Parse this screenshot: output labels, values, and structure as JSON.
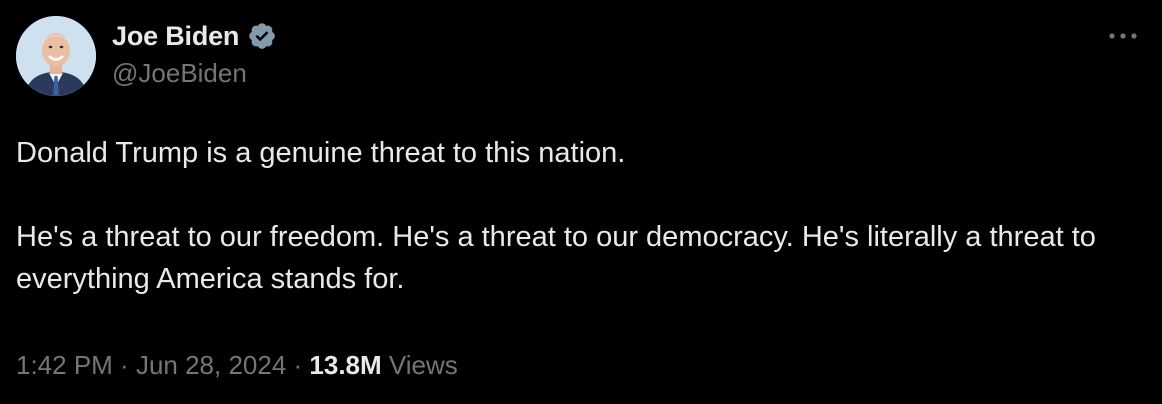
{
  "author": {
    "display_name": "Joe Biden",
    "handle": "@JoeBiden",
    "verified": true,
    "verified_color": "#829aab"
  },
  "tweet": {
    "paragraph_1": "Donald Trump is a genuine threat to this nation.",
    "paragraph_2": "He's a threat to our freedom. He's a threat to our democracy. He's literally a threat to everything America stands for."
  },
  "meta": {
    "time": "1:42 PM",
    "separator_1": " · ",
    "date": "Jun 28, 2024",
    "separator_2": " · ",
    "views_count": "13.8M",
    "views_label": " Views"
  },
  "icons": {
    "verified": "verified-badge-icon",
    "more": "more-options-icon"
  },
  "colors": {
    "background": "#000000",
    "primary_text": "#e7e9ea",
    "secondary_text": "#71767b"
  }
}
